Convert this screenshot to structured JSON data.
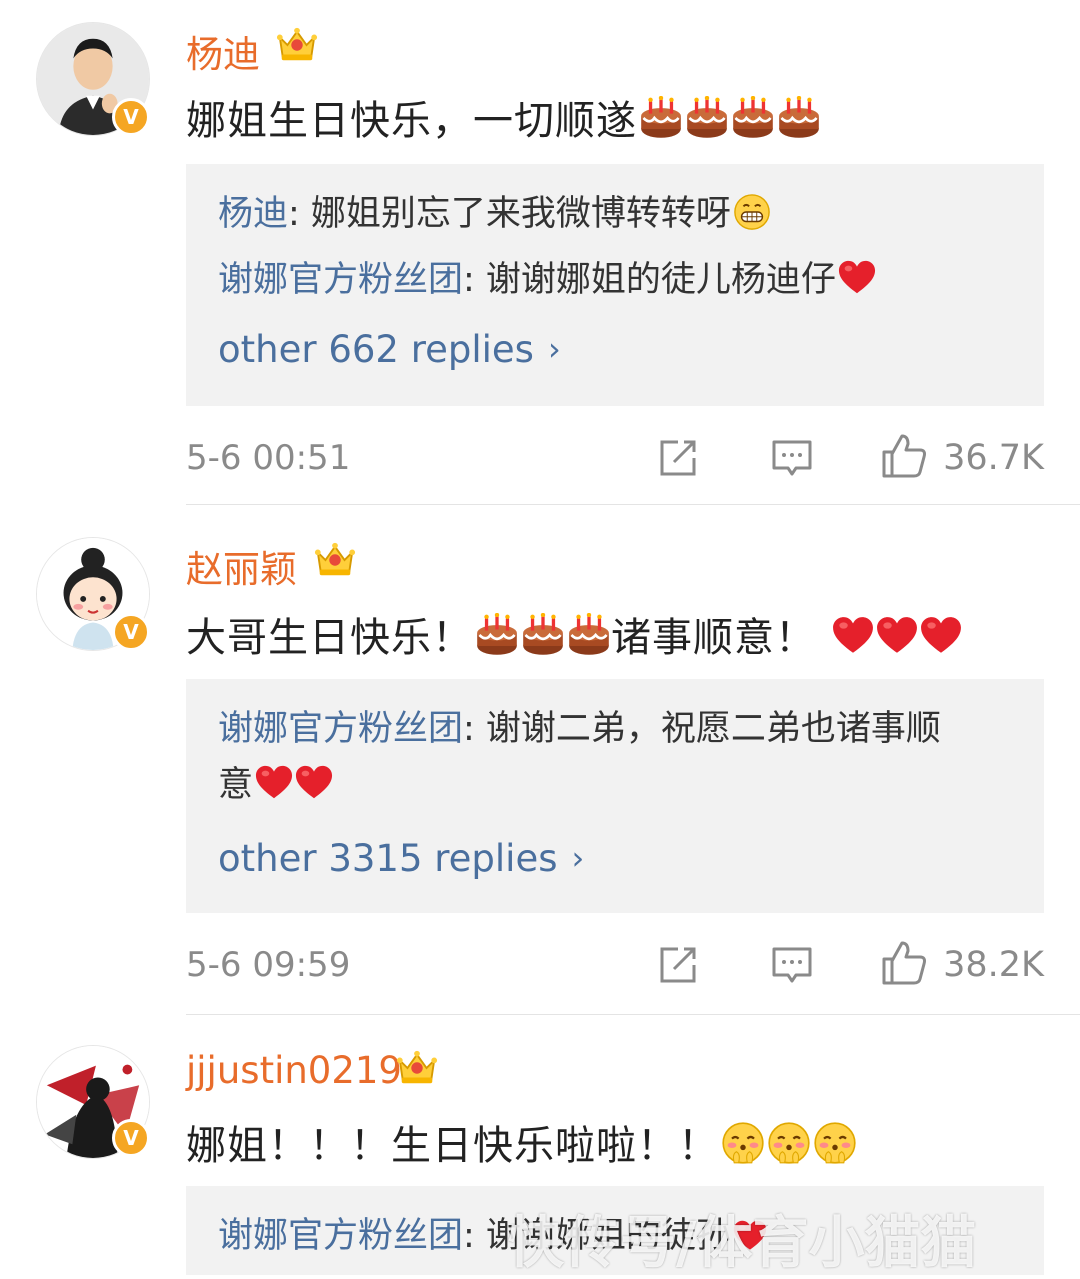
{
  "comments": [
    {
      "username": "杨迪",
      "vip_level": "6",
      "text": "娜姐生日快乐，一切顺遂",
      "replies": [
        {
          "who": "杨迪",
          "text": ": 娜姐别忘了来我微博转转呀"
        },
        {
          "who": "谢娜官方粉丝团",
          "text": ": 谢谢娜姐的徒儿杨迪仔"
        }
      ],
      "more_label": "other 662 replies",
      "time": "5-6 00:51",
      "likes": "36.7K"
    },
    {
      "username": "赵丽颖",
      "vip_level": "7",
      "text": "大哥生日快乐！",
      "text_after": "诸事顺意！",
      "replies": [
        {
          "who": "谢娜官方粉丝团",
          "text": ": 谢谢二弟，祝愿二弟也诸事顺",
          "text_line2": "意"
        }
      ],
      "more_label": "other 3315 replies",
      "time": "5-6 09:59",
      "likes": "38.2K"
    },
    {
      "username": "jjjustin0219",
      "vip_level": "6",
      "text": "娜姐！！！生日快乐啦啦！！",
      "replies": [
        {
          "who": "谢娜官方粉丝团",
          "text": ": 谢谢娜姐的徒孙"
        }
      ]
    }
  ],
  "watermark": "快传号/体育小猫猫",
  "colors": {
    "username": "#e86c2b",
    "link": "#4a6f9e",
    "reply_bg": "#f2f2f2",
    "meta": "#8a8a8a"
  },
  "icons": [
    "crown-vip-icon",
    "verified-badge-icon",
    "cake-emoji",
    "heart-emoji",
    "grin-emoji",
    "blush-emoji",
    "share-icon",
    "comment-icon",
    "like-icon",
    "chevron-right-icon"
  ]
}
